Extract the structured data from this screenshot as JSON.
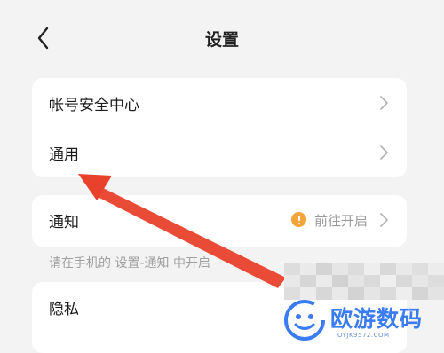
{
  "header": {
    "title": "设置",
    "back_icon": "chevron-left-icon"
  },
  "sections": {
    "account_security": {
      "label": "帐号安全中心"
    },
    "general": {
      "label": "通用"
    },
    "notifications": {
      "label": "通知",
      "status": "前往开启",
      "status_icon": "warning-icon",
      "status_color": "#f2a53a"
    },
    "notification_hint": "请在手机的 设置-通知 中开启",
    "privacy": {
      "label": "隐私"
    }
  },
  "annotation": {
    "arrow_color": "#e8412c",
    "points_to": "通用"
  },
  "watermark": {
    "name": "欧游数码",
    "url": "OYJK9572.COM",
    "color": "#3a7cf2"
  }
}
